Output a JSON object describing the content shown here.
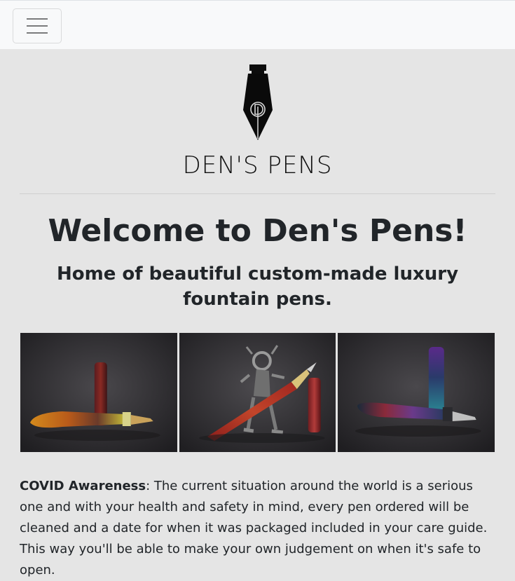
{
  "navbar": {
    "toggle_icon": "hamburger-icon"
  },
  "brand": {
    "logo_icon": "fountain-pen-nib-icon",
    "name": "DEN'S PENS"
  },
  "hero": {
    "title": "Welcome to Den's Pens!",
    "subtitle": "Home of beautiful custom-made luxury fountain pens."
  },
  "gallery": {
    "images": [
      {
        "name": "pen-photo-yellow-orange",
        "icon": "pen-photo"
      },
      {
        "name": "pen-photo-red-with-robot",
        "icon": "pen-photo"
      },
      {
        "name": "pen-photo-blue-purple",
        "icon": "pen-photo"
      }
    ]
  },
  "notice": {
    "label": "COVID Awareness",
    "text": ": The current situation around the world is a serious one and with your health and safety in mind, every pen ordered will be cleaned and a date for when it was packaged included in your care guide. This way you'll be able to make your own judgement on when it's safe to open."
  },
  "colors": {
    "page_bg": "#e5e5e5",
    "navbar_bg": "#f8f9fa",
    "text": "#212529"
  }
}
